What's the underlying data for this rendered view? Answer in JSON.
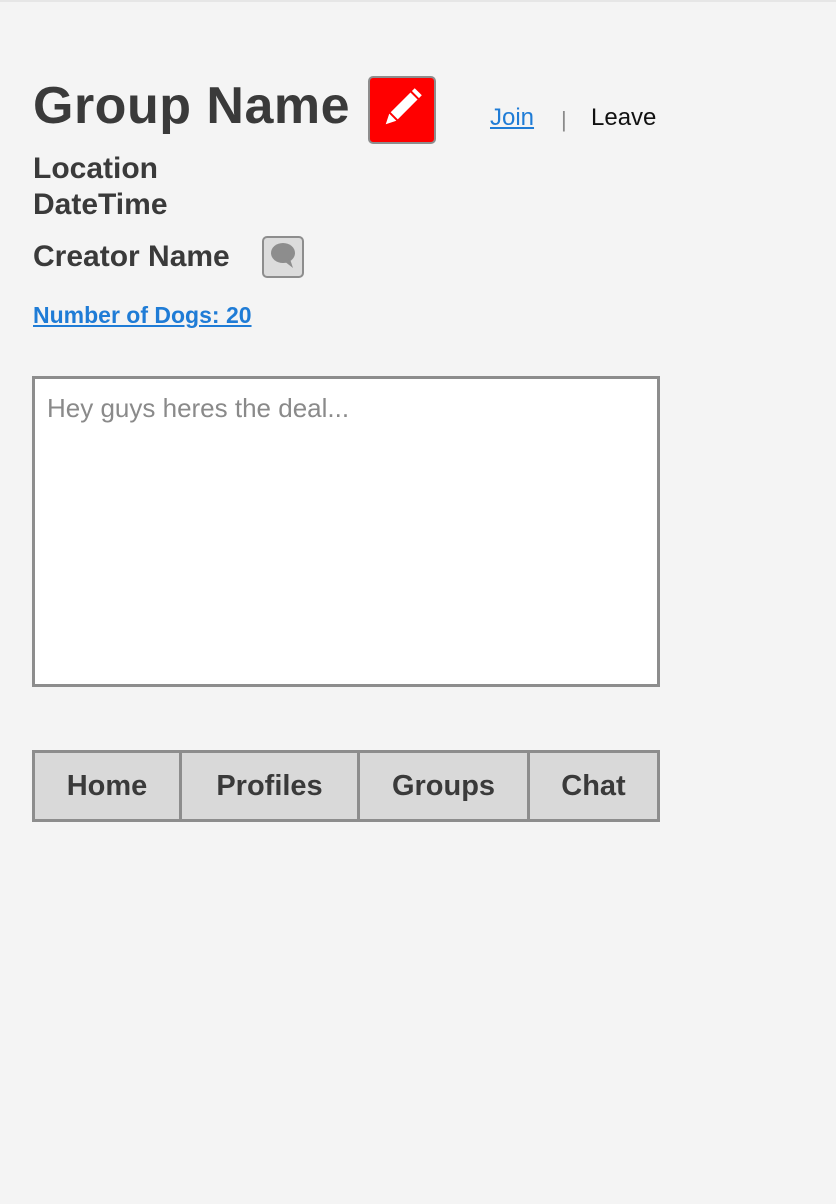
{
  "group": {
    "name": "Group Name",
    "location": "Location",
    "datetime": "DateTime",
    "creator": "Creator Name"
  },
  "actions": {
    "join_label": "Join",
    "separator": "|",
    "leave_label": "Leave",
    "edit_icon": "pencil-icon",
    "chat_icon": "speech-bubble-icon"
  },
  "dogs": {
    "label": "Number of Dogs: 20"
  },
  "message": {
    "placeholder": "Hey guys heres the deal...",
    "value": ""
  },
  "nav": {
    "home": "Home",
    "profiles": "Profiles",
    "groups": "Groups",
    "chat": "Chat"
  },
  "colors": {
    "edit_button": "#ff0000",
    "link": "#1f7cd6",
    "background": "#f4f4f4",
    "tab_background": "#d9d9d9"
  }
}
